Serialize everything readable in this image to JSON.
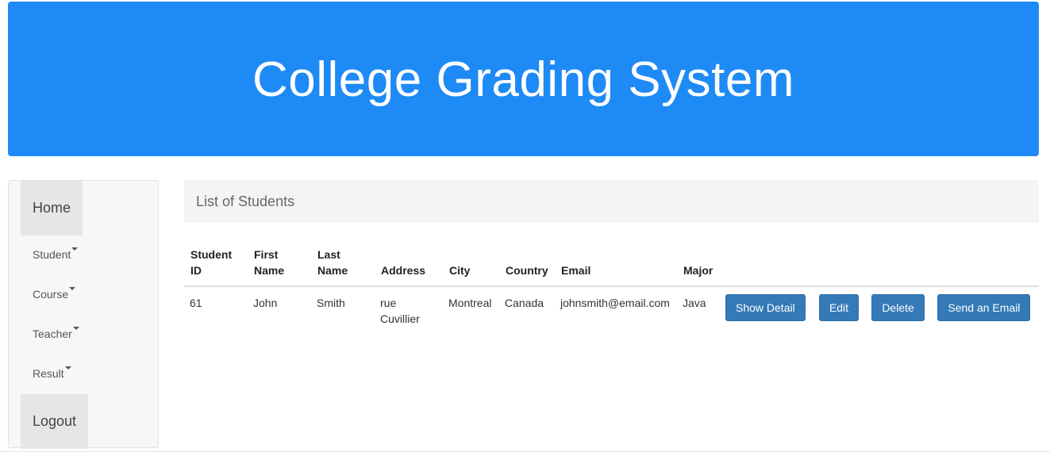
{
  "header": {
    "title": "College Grading System",
    "background": "#1e8af5"
  },
  "sidebar": {
    "home": "Home",
    "items": [
      {
        "label": "Student",
        "icon": "caret-down-icon"
      },
      {
        "label": "Course",
        "icon": "caret-down-icon"
      },
      {
        "label": "Teacher",
        "icon": "caret-down-icon"
      },
      {
        "label": "Result",
        "icon": "caret-down-icon"
      }
    ],
    "logout": "Logout"
  },
  "main": {
    "panel_title": "List of Students",
    "table": {
      "headers": {
        "student_id": [
          "Student",
          "ID"
        ],
        "first_name": [
          "First",
          "Name"
        ],
        "last_name": [
          "Last",
          "Name"
        ],
        "address": "Address",
        "city": "City",
        "country": "Country",
        "email": "Email",
        "major": "Major"
      },
      "rows": [
        {
          "student_id": "61",
          "first_name": "John",
          "last_name": "Smith",
          "address": [
            "rue",
            "Cuvillier"
          ],
          "city": "Montreal",
          "country": "Canada",
          "email": "johnsmith@email.com",
          "major": "Java",
          "actions": {
            "show_detail": "Show Detail",
            "edit": "Edit",
            "delete": "Delete",
            "send_email": "Send an Email"
          }
        }
      ]
    },
    "button_color": "#337ab7"
  }
}
